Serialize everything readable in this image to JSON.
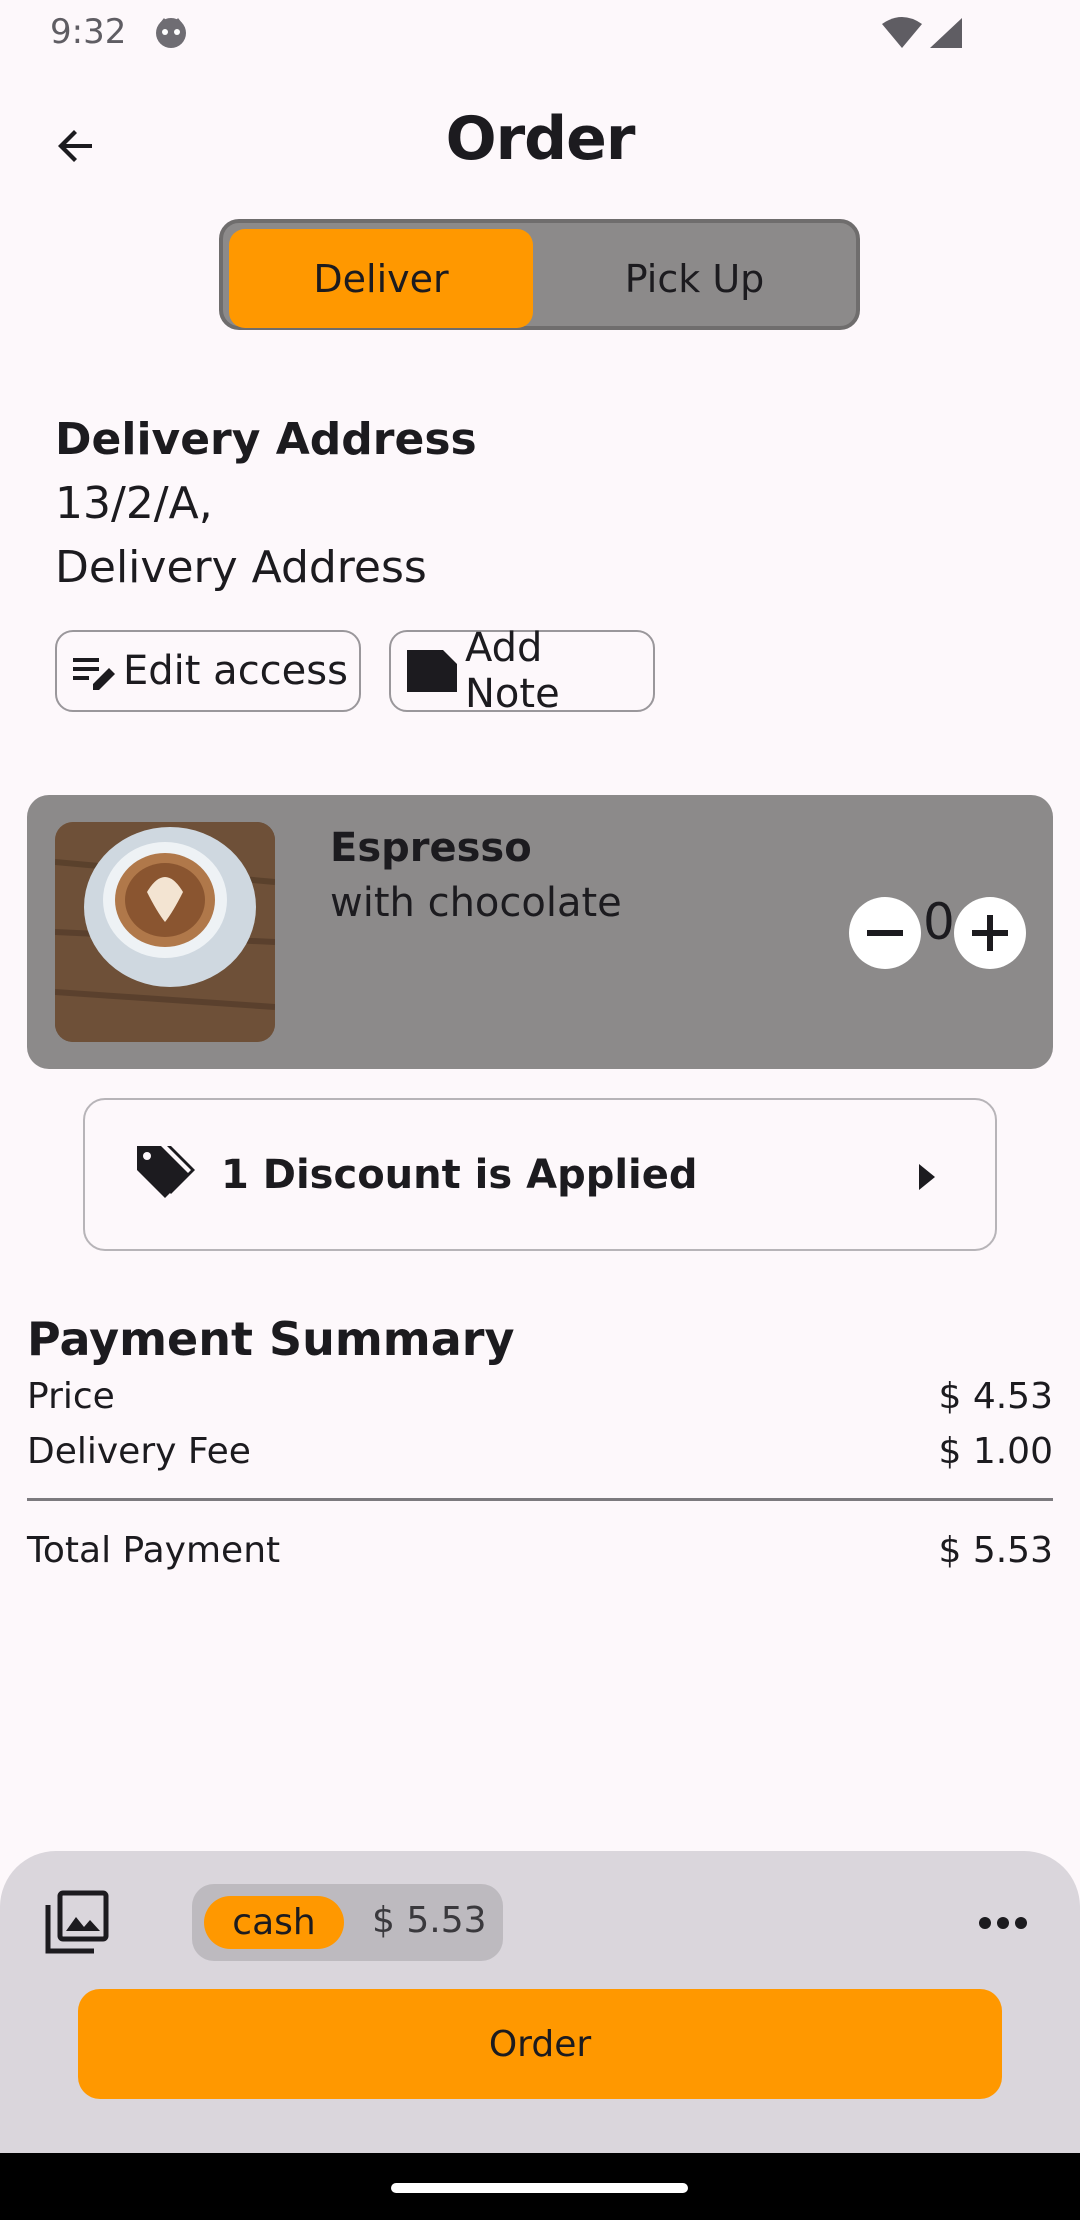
{
  "status_bar": {
    "time": "9:32"
  },
  "app_bar": {
    "title": "Order"
  },
  "mode_toggle": {
    "options": [
      "Deliver",
      "Pick Up"
    ],
    "selected": "Deliver"
  },
  "delivery": {
    "heading": "Delivery Address",
    "line1": "13/2/A,",
    "line2": "Delivery Address",
    "edit_label": "Edit access",
    "note_label": "Add Note"
  },
  "product": {
    "name": "Espresso",
    "subtitle": "with chocolate",
    "quantity": "0"
  },
  "discount": {
    "text": "1 Discount is Applied"
  },
  "payment_summary": {
    "title": "Payment Summary",
    "rows": [
      {
        "label": "Price",
        "value": "$ 4.53"
      },
      {
        "label": "Delivery Fee",
        "value": "$ 1.00"
      }
    ],
    "total": {
      "label": "Total Payment",
      "value": "$ 5.53"
    }
  },
  "bottom_bar": {
    "payment_method": "cash",
    "amount": "$ 5.53",
    "order_label": "Order"
  },
  "colors": {
    "accent": "#ff9800",
    "card": "#8c8a8a",
    "sheet": "#dad6dc"
  }
}
